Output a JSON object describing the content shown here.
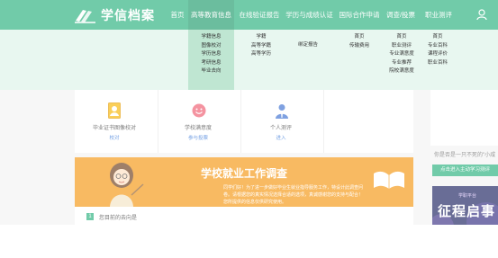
{
  "logo": {
    "text": "学信档案"
  },
  "nav": {
    "items": [
      "首页",
      "高等教育信息",
      "在线验证报告",
      "学历与成绩认证",
      "国际合作申请",
      "调查/投票",
      "职业测评"
    ],
    "active_index": 1
  },
  "dropdown": {
    "col1": [
      "学籍信息",
      "图像校对",
      "学历信息",
      "考研信息",
      "毕业去向"
    ],
    "col2": [
      "学籍",
      "高等学籍",
      "高等学历"
    ],
    "col3": [
      "绑定报告"
    ],
    "col4": [
      "首页",
      "传输费用"
    ],
    "col5": [
      "首页",
      "职业测评",
      "专业满意度",
      "专业推荐",
      "院校满意度"
    ],
    "col6": [
      "首页",
      "专业百科",
      "课程评价",
      "职业百科"
    ]
  },
  "cards": [
    {
      "title": "毕业证书图像校对",
      "link": "校对",
      "icon": "id-photo-icon"
    },
    {
      "title": "学校满意度",
      "link": "参与投票",
      "icon": "smiley-icon"
    },
    {
      "title": "个人测评",
      "link": "进入",
      "icon": "person-icon"
    }
  ],
  "banner": {
    "title": "学校就业工作调查",
    "text": "同学们好！为了进一步做好毕业生就业指导服务工作，特设计此调查问卷。请根据您的真实情况选择合适的选项，真诚感谢您的支持与配合！您所提供的信息仅供研究使用。"
  },
  "question": {
    "number": "1",
    "text": "您目前的去向是"
  },
  "side": {
    "caption": "你是否是一只不死的\"小咸",
    "button": "点击进入主动学习测评",
    "ad_small": "学职平台",
    "ad_big": "征程启事"
  },
  "colors": {
    "brand_green": "#25b07b",
    "banner_orange": "#f5960e",
    "link_blue": "#2a6fd6"
  }
}
